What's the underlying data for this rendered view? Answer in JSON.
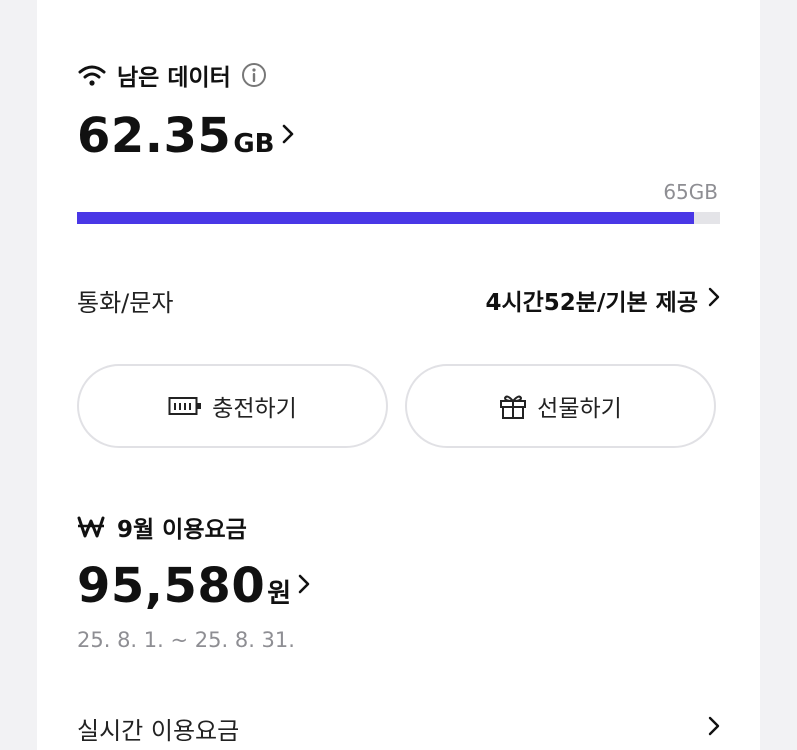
{
  "data_section": {
    "title": "남은 데이터",
    "remaining_value": "62.35",
    "remaining_unit": "GB",
    "total_label": "65GB",
    "usage_fraction": 0.959
  },
  "call_sms": {
    "label": "통화/문자",
    "value": "4시간52분/기본 제공"
  },
  "actions": {
    "charge_label": "충전하기",
    "gift_label": "선물하기"
  },
  "billing": {
    "title": "9월 이용요금",
    "amount": "95,580",
    "unit": "원",
    "period": "25. 8. 1. ~ 25. 8. 31."
  },
  "realtime": {
    "label": "실시간 이용요금"
  },
  "colors": {
    "accent": "#4937e6",
    "track": "#e4e4e8",
    "muted_text": "#8e8e93",
    "border": "#e1e1e5"
  },
  "icons": {
    "data_header": "wifi-icon",
    "info": "info-icon",
    "chevron": "chevron-right-icon",
    "charge": "battery-charge-icon",
    "gift": "gift-icon",
    "billing_header": "won-currency-icon"
  }
}
